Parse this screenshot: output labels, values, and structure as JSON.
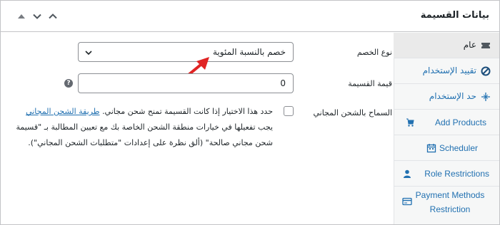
{
  "header": {
    "title": "بيانات القسيمة",
    "controls": [
      "chevron-up-icon",
      "chevron-down-icon",
      "triangle-up-icon"
    ]
  },
  "sidebar": {
    "items": [
      {
        "label": "عام",
        "icon": "ticket-icon",
        "active": true
      },
      {
        "label": "تقييد الإستخدام",
        "icon": "block-icon"
      },
      {
        "label": "حد الإستخدام",
        "icon": "plus-cross-icon"
      },
      {
        "label": "Add Products",
        "icon": "cart-icon"
      },
      {
        "label": "Scheduler",
        "icon": "calendar-icon"
      },
      {
        "label": "Role Restrictions",
        "icon": "user-icon"
      },
      {
        "label": "Payment Methods Restriction",
        "icon": "card-icon"
      }
    ]
  },
  "form": {
    "discount_type_label": "نوع الخصم",
    "discount_type_value": "خصم بالنسبة المئوية",
    "coupon_amount_label": "قيمة القسيمة",
    "coupon_amount_value": "0",
    "free_shipping_label": "السماح بالشحن المجاني",
    "free_shipping_text_before": "حدد هذا الاختيار إذا كانت القسيمة تمنح شحن مجاني.",
    "free_shipping_link": "طريقة الشحن المجاني",
    "free_shipping_text_after": "يجب تفعيلها في خيارات منطقة الشحن الخاصة بك مع تعيين المطالبة بـ \"قسيمة شحن مجاني صالحة\" (ألق نظرة على إعدادات \"متطلبات الشحن المجاني\").",
    "help_glyph": "?"
  },
  "colors": {
    "link": "#2271b1",
    "arrow": "#e02424",
    "active_tab": "#eaeaea",
    "sidebar_bg": "#f6f7f7"
  }
}
